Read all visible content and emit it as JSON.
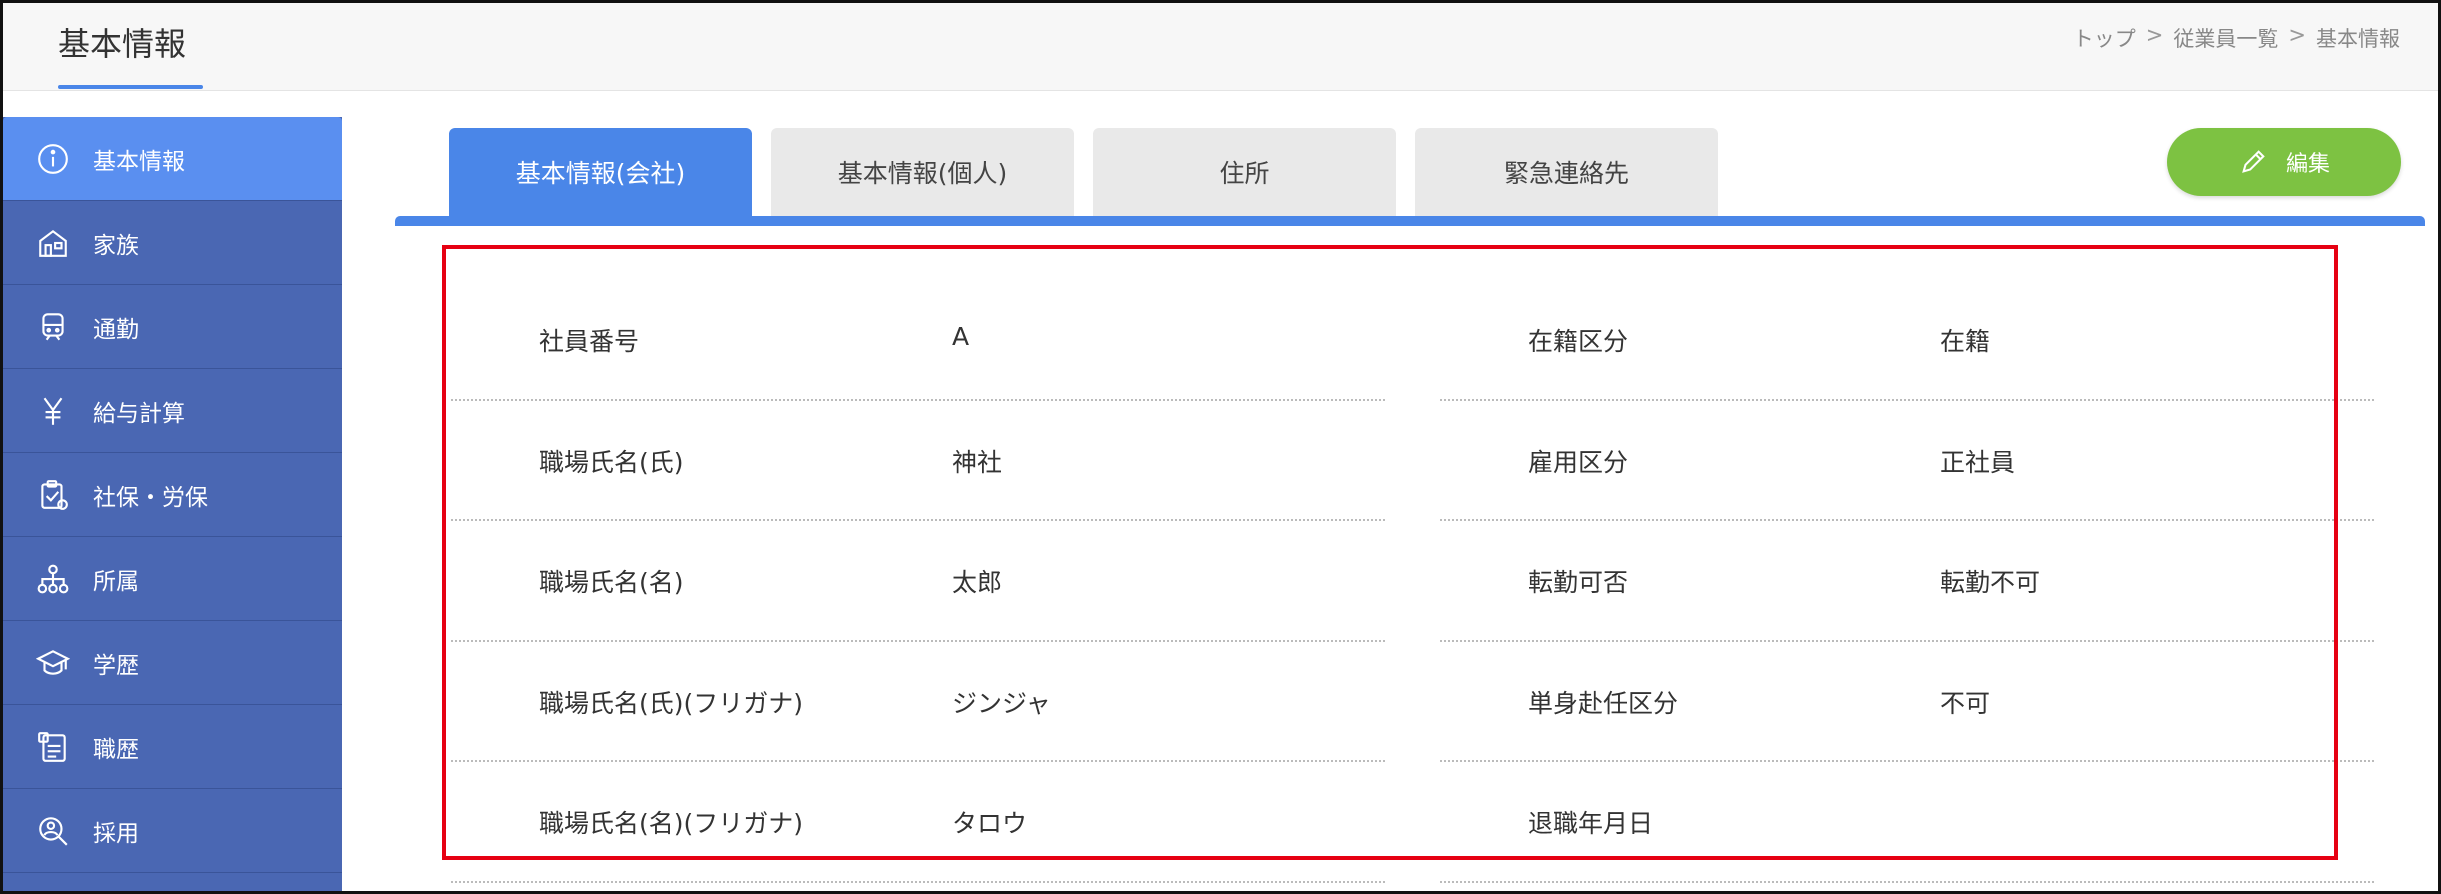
{
  "header": {
    "title": "基本情報",
    "breadcrumb": [
      "トップ",
      "従業員一覧",
      "基本情報"
    ],
    "breadcrumb_sep": ">"
  },
  "sidebar": {
    "items": [
      {
        "label": "基本情報",
        "icon": "info-icon",
        "active": true
      },
      {
        "label": "家族",
        "icon": "house-icon",
        "active": false
      },
      {
        "label": "通勤",
        "icon": "train-icon",
        "active": false
      },
      {
        "label": "給与計算",
        "icon": "yen-icon",
        "active": false
      },
      {
        "label": "社保・労保",
        "icon": "clipboard-check-icon",
        "active": false
      },
      {
        "label": "所属",
        "icon": "org-chart-icon",
        "active": false
      },
      {
        "label": "学歴",
        "icon": "graduation-cap-icon",
        "active": false
      },
      {
        "label": "職歴",
        "icon": "document-list-icon",
        "active": false
      },
      {
        "label": "採用",
        "icon": "person-search-icon",
        "active": false
      }
    ]
  },
  "tabs": [
    {
      "label": "基本情報(会社)",
      "active": true
    },
    {
      "label": "基本情報(個人)",
      "active": false
    },
    {
      "label": "住所",
      "active": false
    },
    {
      "label": "緊急連絡先",
      "active": false
    }
  ],
  "edit_button": {
    "label": "編集",
    "icon": "pencil-icon"
  },
  "fields_left": [
    {
      "label": "社員番号",
      "value": "A"
    },
    {
      "label": "職場氏名(氏)",
      "value": "神社"
    },
    {
      "label": "職場氏名(名)",
      "value": "太郎"
    },
    {
      "label": "職場氏名(氏)(フリガナ)",
      "value": "ジンジャ"
    },
    {
      "label": "職場氏名(名)(フリガナ)",
      "value": "タロウ"
    }
  ],
  "fields_right": [
    {
      "label": "在籍区分",
      "value": "在籍"
    },
    {
      "label": "雇用区分",
      "value": "正社員"
    },
    {
      "label": "転勤可否",
      "value": "転勤不可"
    },
    {
      "label": "単身赴任区分",
      "value": "不可"
    },
    {
      "label": "退職年月日",
      "value": ""
    }
  ],
  "colors": {
    "accent": "#4a86e8",
    "sidebar": "#4a67b3",
    "edit_button": "#7dc242",
    "highlight": "#e60012"
  }
}
